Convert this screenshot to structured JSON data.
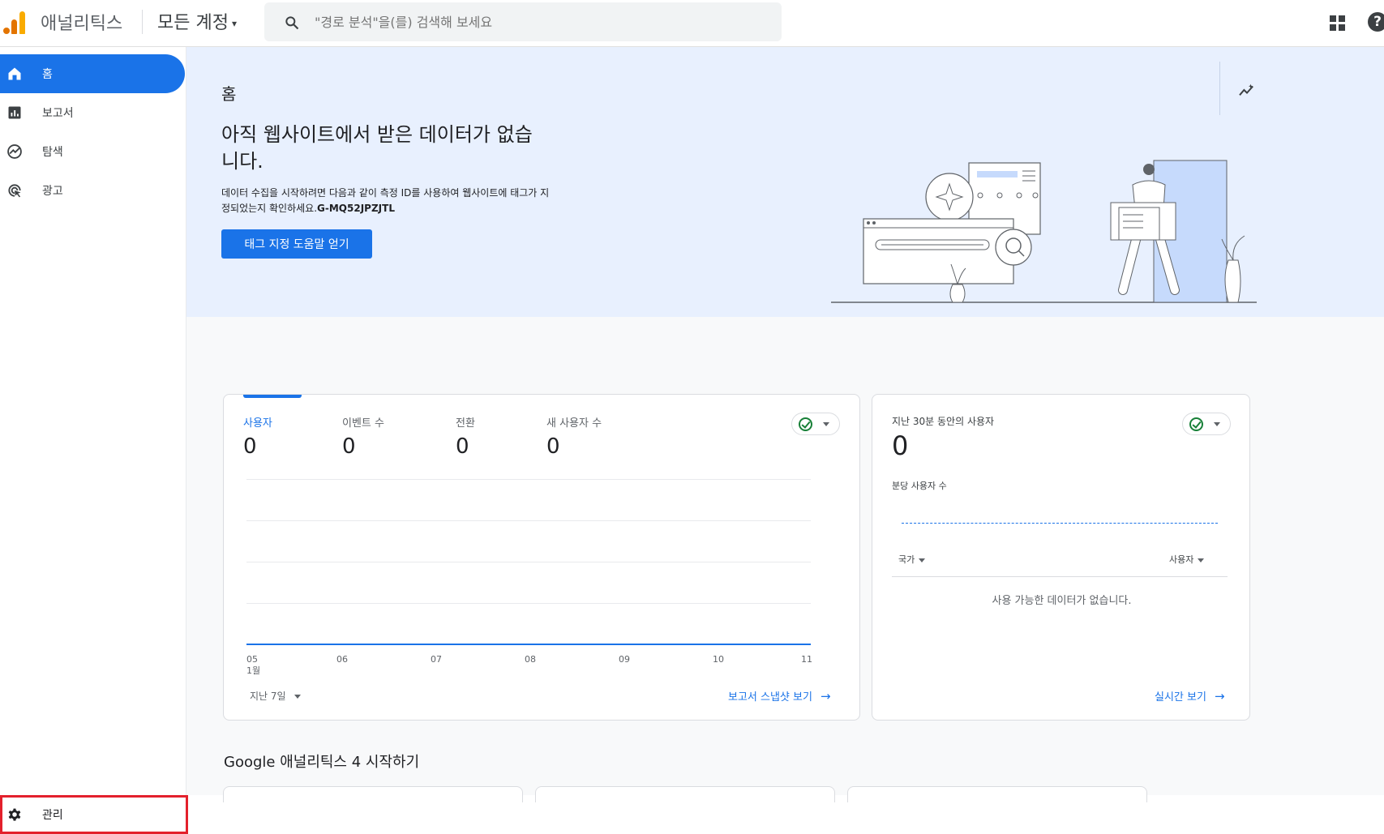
{
  "header": {
    "app_title": "애널리틱스",
    "account_label": "모든 계정",
    "search_placeholder": "\"경로 분석\"을(를) 검색해 보세요"
  },
  "sidebar": {
    "items": [
      {
        "label": "홈",
        "icon": "home-icon",
        "active": true
      },
      {
        "label": "보고서",
        "icon": "bar-chart-icon",
        "active": false
      },
      {
        "label": "탐색",
        "icon": "explore-icon",
        "active": false
      },
      {
        "label": "광고",
        "icon": "ads-icon",
        "active": false
      }
    ],
    "admin_label": "관리"
  },
  "hero": {
    "title": "홈",
    "headline": "아직 웹사이트에서 받은 데이터가 없습니다.",
    "description": "데이터 수집을 시작하려면 다음과 같이 측정 ID를 사용하여 웹사이트에 태그가 지정되었는지 확인하세요.",
    "measurement_id": "G-MQ52JPZJTL",
    "button_label": "태그 지정 도움말 얻기"
  },
  "overview_card": {
    "metrics": [
      {
        "label": "사용자",
        "value": "0",
        "selected": true
      },
      {
        "label": "이벤트 수",
        "value": "0",
        "selected": false
      },
      {
        "label": "전환",
        "value": "0",
        "selected": false
      },
      {
        "label": "새 사용자 수",
        "value": "0",
        "selected": false
      }
    ],
    "x_ticks": [
      "05",
      "06",
      "07",
      "08",
      "09",
      "10",
      "11"
    ],
    "x_month": "1월",
    "period_label": "지난 7일",
    "link_label": "보고서 스냅샷 보기"
  },
  "realtime_card": {
    "title": "지난 30분 동안의 사용자",
    "value": "0",
    "subtitle": "분당 사용자 수",
    "col_country": "국가",
    "col_users": "사용자",
    "empty_text": "사용 가능한 데이터가 없습니다.",
    "link_label": "실시간 보기"
  },
  "section_heading": "Google 애널리틱스 4 시작하기",
  "colors": {
    "accent": "#1a73e8",
    "hero_bg": "#e8f0fe",
    "success": "#188038",
    "highlight": "#e3202c"
  }
}
